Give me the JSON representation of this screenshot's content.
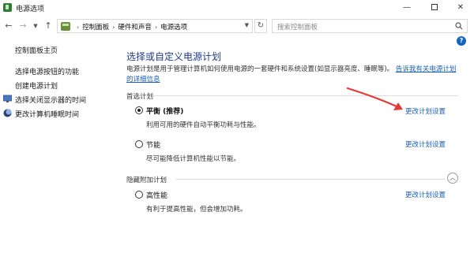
{
  "window": {
    "title": "电源选项",
    "minimize": "—",
    "close": "✕"
  },
  "address": {
    "crumbs": [
      "控制面板",
      "硬件和声音",
      "电源选项"
    ],
    "search_placeholder": "搜索控制面板"
  },
  "sidebar": {
    "home": "控制面板主页",
    "items": [
      {
        "label": "选择电源按钮的功能"
      },
      {
        "label": "创建电源计划"
      },
      {
        "label": "选择关闭显示器的时间"
      },
      {
        "label": "更改计算机睡眠时间"
      }
    ]
  },
  "main": {
    "title": "选择或自定义电源计划",
    "description": "电源计划是用于管理计算机如何使用电源的一套硬件和系统设置(如显示器亮度、睡眠等)。",
    "description_link": "告诉我有关电源计划的详细信息",
    "preferred_label": "首选计划",
    "hidden_label": "隐藏附加计划",
    "plans": [
      {
        "name": "平衡 (推荐)",
        "desc": "利用可用的硬件自动平衡功耗与性能。",
        "link": "更改计划设置",
        "selected": true
      },
      {
        "name": "节能",
        "desc": "尽可能降低计算机性能以节能。",
        "link": "更改计划设置",
        "selected": false
      },
      {
        "name": "高性能",
        "desc": "有利于提高性能，但会增加功耗。",
        "link": "更改计划设置",
        "selected": false
      }
    ]
  },
  "colors": {
    "title_blue": "#1e3a8a",
    "link_blue": "#1a5fb4",
    "annotation_red": "#e53935"
  }
}
